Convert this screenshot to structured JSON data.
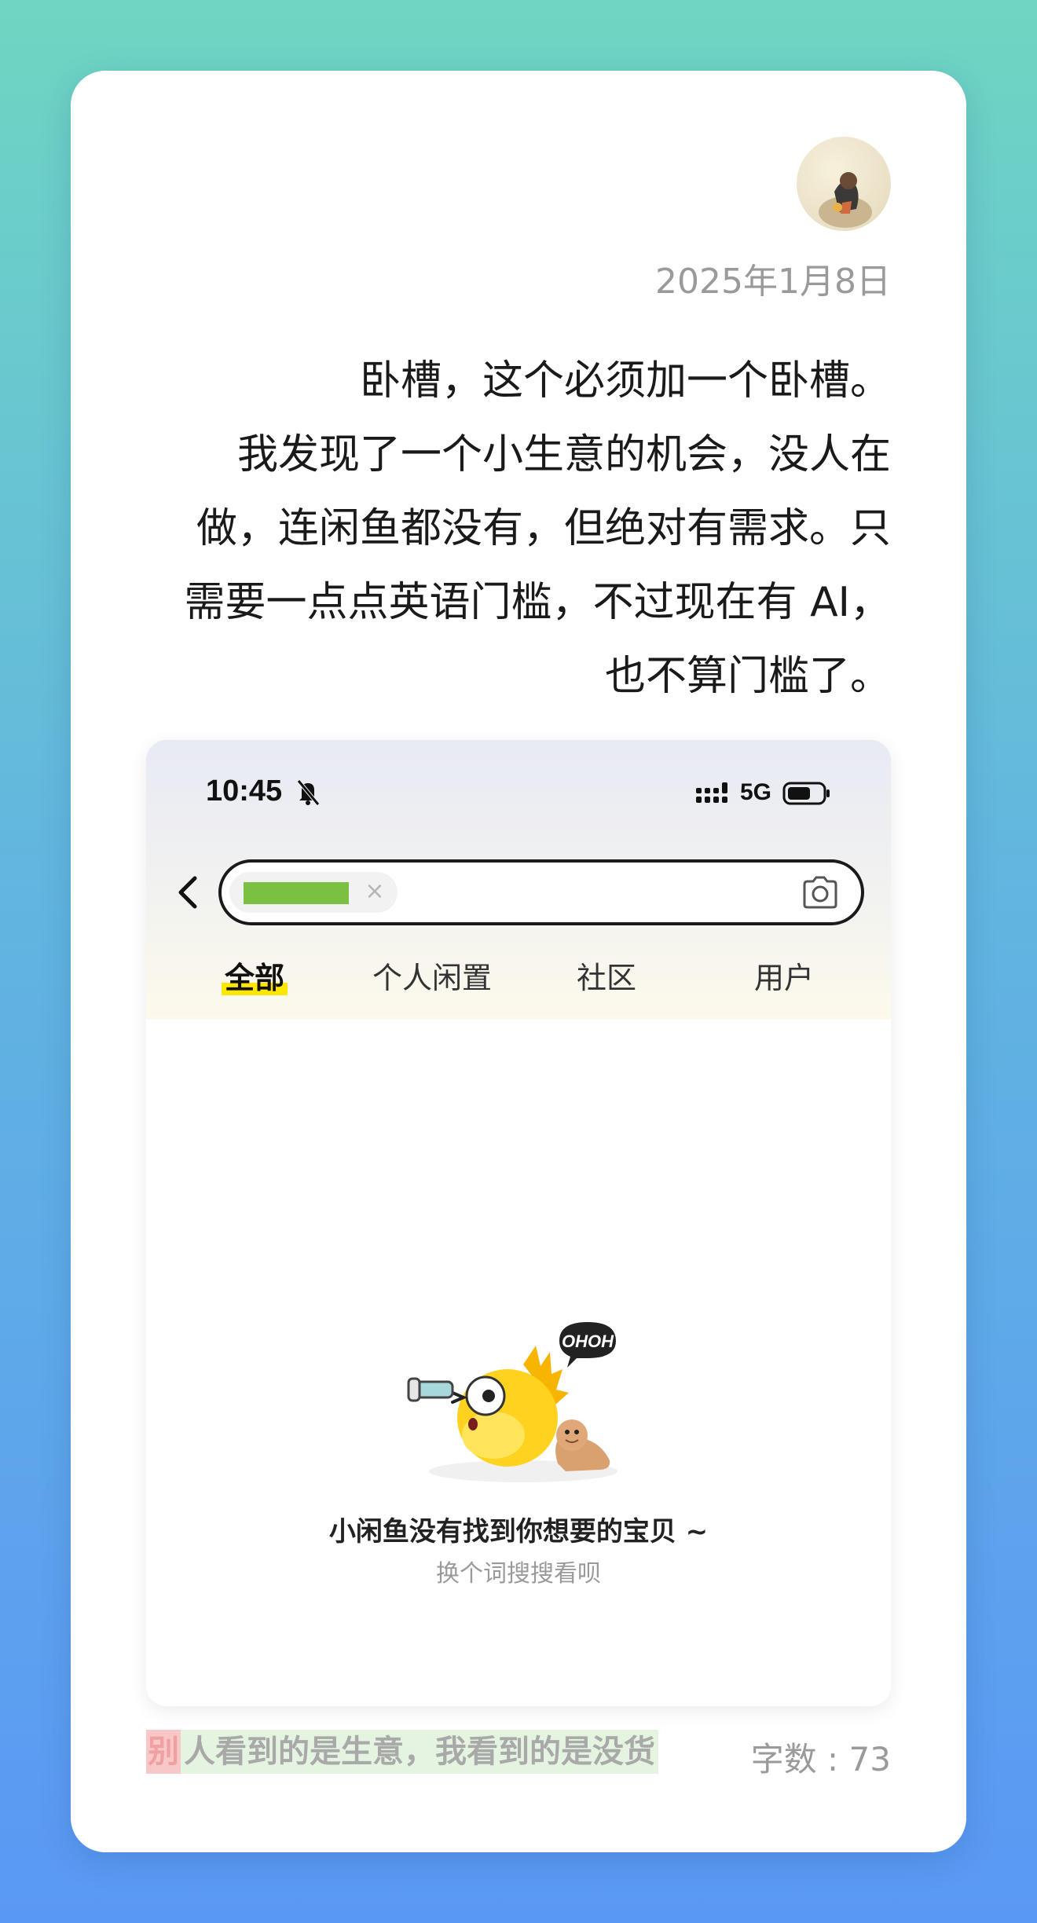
{
  "post": {
    "date": "2025年1月8日",
    "paragraphs": [
      "卧槽，这个必须加一个卧槽。",
      "我发现了一个小生意的机会，没人在做，连闲鱼都没有，但绝对有需求。只需要一点点英语门槛，不过现在有 AI，也不算门槛了。"
    ]
  },
  "screenshot": {
    "status_bar": {
      "time": "10:45",
      "network": "5G",
      "icons": [
        "bell-off-icon",
        "signal-icon",
        "battery-icon"
      ]
    },
    "search": {
      "chip_color": "#7ac143",
      "clear_glyph": "×",
      "icons": [
        "back-icon",
        "clear-icon",
        "camera-icon"
      ]
    },
    "tabs": [
      {
        "label": "全部",
        "active": true
      },
      {
        "label": "个人闲置",
        "active": false
      },
      {
        "label": "社区",
        "active": false
      },
      {
        "label": "用户",
        "active": false
      }
    ],
    "empty_state": {
      "bubble_text": "OHOH",
      "title": "小闲鱼没有找到你想要的宝贝 ~",
      "subtitle": "换个词搜搜看呗"
    }
  },
  "footer": {
    "quote_first": "别",
    "quote_rest": "人看到的是生意，我看到的是没货",
    "word_count": "字数 : 73"
  },
  "colors": {
    "accent_tab": "#ffe600",
    "quote_highlight_red": "#f8c7c7",
    "quote_highlight_green": "#e4f4e0"
  }
}
